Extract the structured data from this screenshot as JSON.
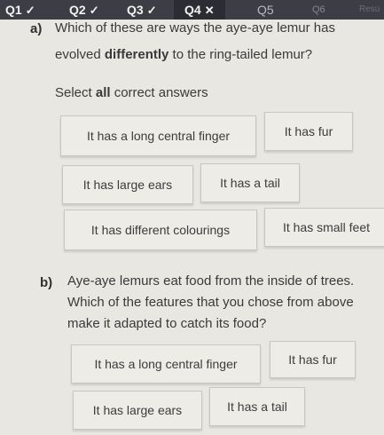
{
  "tabs": [
    {
      "label": "Q1",
      "mark": "✓"
    },
    {
      "label": "Q2",
      "mark": "✓"
    },
    {
      "label": "Q3",
      "mark": "✓"
    },
    {
      "label": "Q4",
      "mark": "✕"
    },
    {
      "label": "Q5",
      "mark": ""
    },
    {
      "label": "Q6",
      "mark": ""
    },
    {
      "label": "Resu",
      "mark": ""
    }
  ],
  "part_a": {
    "label": "a)",
    "line1": "Which of these are ways the aye-aye lemur has",
    "line2_pre": "evolved ",
    "line2_bold": "differently",
    "line2_post": " to the ring-tailed lemur?",
    "instr_pre": "Select ",
    "instr_bold": "all",
    "instr_post": " correct answers",
    "options": [
      "It has a long central finger",
      "It has fur",
      "It has large ears",
      "It has a tail",
      "It has different colourings",
      "It has small feet"
    ]
  },
  "part_b": {
    "label": "b)",
    "line1": "Aye-aye lemurs eat food from the inside of trees.",
    "line2": "Which of the features that you chose from above",
    "line3": "make it adapted to catch its food?",
    "options": [
      "It has a long central finger",
      "It has fur",
      "It has large ears",
      "It has a tail"
    ]
  }
}
